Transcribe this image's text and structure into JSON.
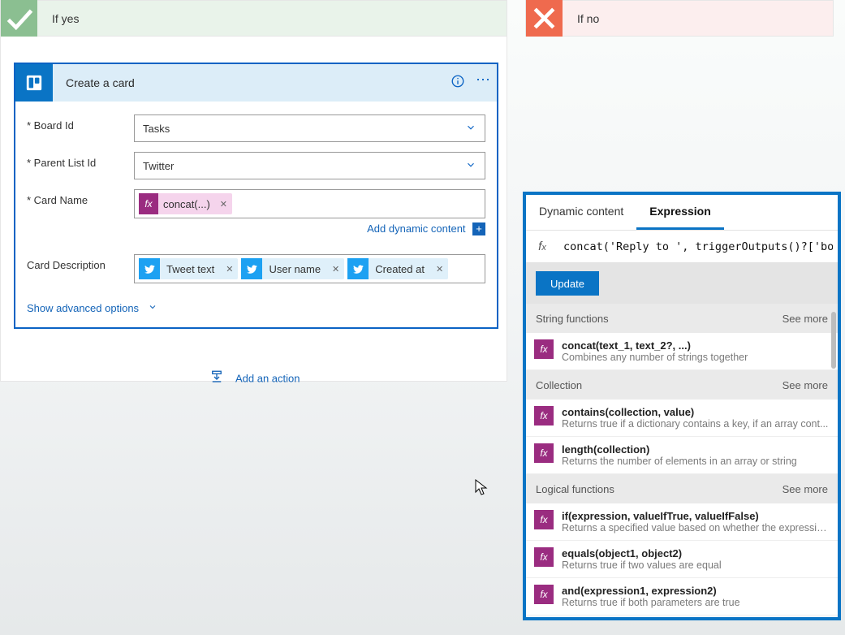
{
  "branches": {
    "yes_label": "If yes",
    "no_label": "If no"
  },
  "card": {
    "title": "Create a card",
    "fields": {
      "board": {
        "label": "Board Id",
        "value": "Tasks"
      },
      "list": {
        "label": "Parent List Id",
        "value": "Twitter"
      },
      "name": {
        "label": "Card Name",
        "token": "concat(...)"
      },
      "desc": {
        "label": "Card Description",
        "tokens": [
          "Tweet text",
          "User name",
          "Created at"
        ]
      }
    },
    "add_dynamic": "Add dynamic content",
    "show_advanced": "Show advanced options"
  },
  "add_action": "Add an action",
  "panel": {
    "tabs": {
      "dynamic": "Dynamic content",
      "expression": "Expression"
    },
    "expression_value": "concat('Reply to ', triggerOutputs()?['bod",
    "update": "Update",
    "see_more": "See more",
    "sections": [
      {
        "title": "String functions",
        "items": [
          {
            "sig": "concat(text_1, text_2?, ...)",
            "desc": "Combines any number of strings together"
          }
        ]
      },
      {
        "title": "Collection",
        "items": [
          {
            "sig": "contains(collection, value)",
            "desc": "Returns true if a dictionary contains a key, if an array cont..."
          },
          {
            "sig": "length(collection)",
            "desc": "Returns the number of elements in an array or string"
          }
        ]
      },
      {
        "title": "Logical functions",
        "items": [
          {
            "sig": "if(expression, valueIfTrue, valueIfFalse)",
            "desc": "Returns a specified value based on whether the expressio..."
          },
          {
            "sig": "equals(object1, object2)",
            "desc": "Returns true if two values are equal"
          },
          {
            "sig": "and(expression1, expression2)",
            "desc": "Returns true if both parameters are true"
          }
        ]
      }
    ]
  }
}
